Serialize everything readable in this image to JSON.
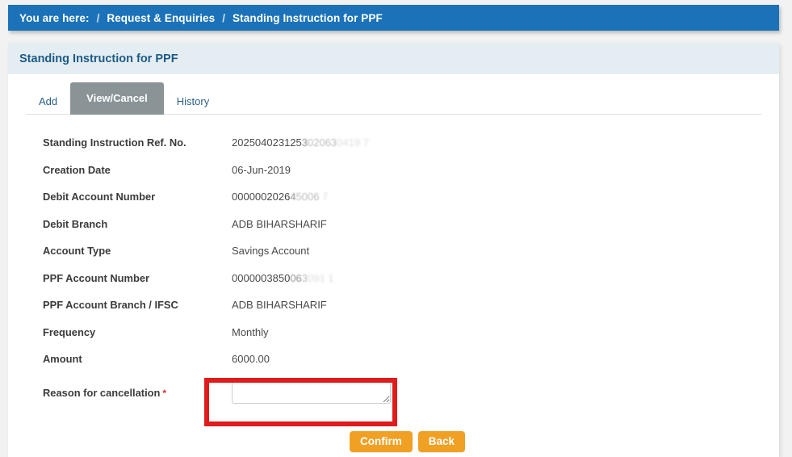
{
  "breadcrumb": {
    "prefix": "You are here:",
    "separator": "/",
    "items": [
      {
        "label": "Request & Enquiries"
      },
      {
        "label": "Standing Instruction for PPF"
      }
    ]
  },
  "panel": {
    "title": "Standing Instruction for PPF"
  },
  "tabs": [
    {
      "id": "add",
      "label": "Add",
      "active": false
    },
    {
      "id": "view-cancel",
      "label": "View/Cancel",
      "active": true
    },
    {
      "id": "history",
      "label": "History",
      "active": false
    }
  ],
  "form": {
    "rows": [
      {
        "label": "Standing Instruction Ref. No.",
        "value_clear": "202504023125",
        "value_fade1": "3",
        "value_fade2": "02063",
        "value_fade3": "0419 7"
      },
      {
        "label": "Creation Date",
        "value_clear": "06-Jun-2019",
        "value_fade1": "",
        "value_fade2": "",
        "value_fade3": ""
      },
      {
        "label": "Debit Account Number",
        "value_clear": "0000002026",
        "value_fade1": "4",
        "value_fade2": "5006",
        "value_fade3": "  7"
      },
      {
        "label": "Debit Branch",
        "value_clear": "ADB BIHARSHARIF",
        "value_fade1": "",
        "value_fade2": "",
        "value_fade3": ""
      },
      {
        "label": "Account Type",
        "value_clear": "Savings Account",
        "value_fade1": "",
        "value_fade2": "",
        "value_fade3": ""
      },
      {
        "label": "PPF Account Number",
        "value_clear": "0000003850",
        "value_fade1": "06",
        "value_fade2": "3",
        "value_fade3": "091 1"
      },
      {
        "label": "PPF Account Branch / IFSC",
        "value_clear": "ADB BIHARSHARIF",
        "value_fade1": "",
        "value_fade2": "",
        "value_fade3": ""
      },
      {
        "label": "Frequency",
        "value_clear": "Monthly",
        "value_fade1": "",
        "value_fade2": "",
        "value_fade3": ""
      },
      {
        "label": "Amount",
        "value_clear": "6000.00",
        "value_fade1": "",
        "value_fade2": "",
        "value_fade3": ""
      }
    ],
    "reason": {
      "label": "Reason for cancellation",
      "required_marker": "*",
      "value": "",
      "placeholder": ""
    }
  },
  "actions": {
    "confirm_label": "Confirm",
    "back_label": "Back"
  },
  "colors": {
    "breadcrumb_bar": "#1b72b8",
    "panel_header": "#e4eef2",
    "panel_title": "#1d5a86",
    "active_tab": "#8a9497",
    "tab_text": "#2b5f87",
    "button_orange": "#f0a023",
    "highlight_red": "#e01b1b",
    "required_star": "#d0343a"
  }
}
